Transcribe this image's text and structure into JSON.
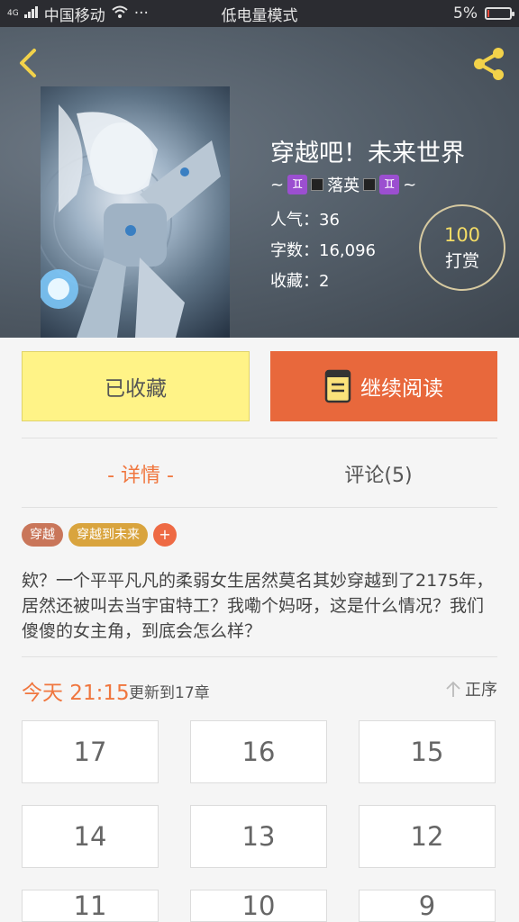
{
  "statusbar": {
    "carrier": "中国移动",
    "network_type": "4G",
    "dots": "···",
    "mode": "低电量模式",
    "battery": "5%"
  },
  "book": {
    "title": "穿越吧！未来世界",
    "author_prefix": "~",
    "author_gem": "♊",
    "author": "落英",
    "author_suffix": "~",
    "popularity_label": "人气：",
    "popularity": "36",
    "words_label": "字数：",
    "words": "16,096",
    "favorites_label": "收藏：",
    "favorites": "2"
  },
  "reward": {
    "amount": "100",
    "label": "打赏"
  },
  "actions": {
    "favorited_label": "已收藏",
    "continue_label": "继续阅读"
  },
  "tabs": {
    "detail": "- 详情 -",
    "comments": "评论(5)"
  },
  "tags": [
    {
      "label": "穿越",
      "color": "#c9765a"
    },
    {
      "label": "穿越到未来",
      "color": "#d9a43e"
    }
  ],
  "tag_add": "+",
  "description": "欸？一个平平凡凡的柔弱女生居然莫名其妙穿越到了2175年，居然还被叫去当宇宙特工？我嘞个妈呀，这是什么情况？我们傻傻的女主角，到底会怎么样？",
  "update": {
    "time": "今天 21:15",
    "text": "更新到17章",
    "sort_label": "正序"
  },
  "chapters": [
    "17",
    "16",
    "15",
    "14",
    "13",
    "12",
    "11",
    "10",
    "9"
  ],
  "colors": {
    "accent": "#f0763e",
    "read_button": "#e8683c",
    "fav_button": "#fff387",
    "header_bg": "#56616c"
  }
}
